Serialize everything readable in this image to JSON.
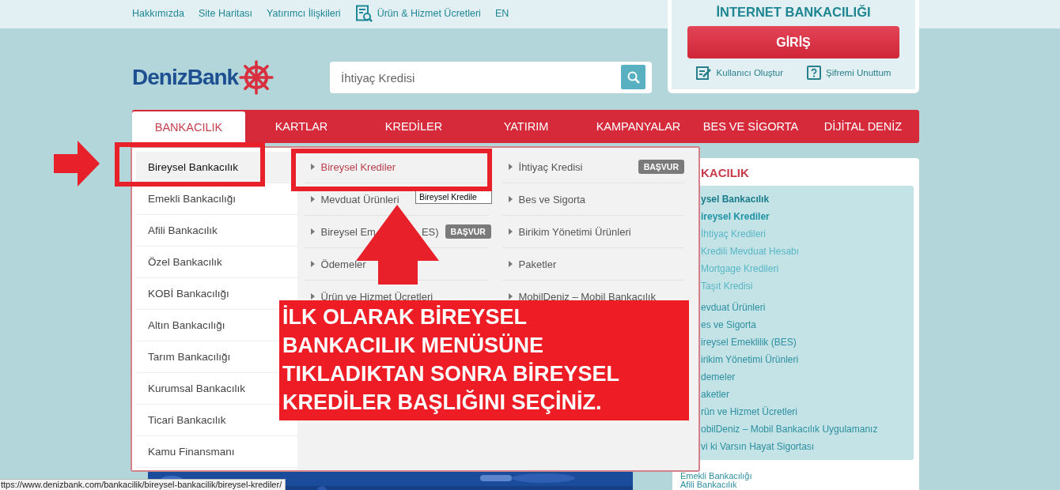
{
  "top_links": [
    {
      "label": "Hakkımızda",
      "kind": "text"
    },
    {
      "label": "Site Haritası",
      "kind": "text"
    },
    {
      "label": "Yatırımcı İlişkileri",
      "kind": "text"
    },
    {
      "label": "Ürün & Hizmet Ücretleri",
      "kind": "icon"
    },
    {
      "label": "EN",
      "kind": "text"
    }
  ],
  "logo": {
    "text": "DenizBank"
  },
  "search": {
    "placeholder": "İhtiyaç Kredisi"
  },
  "login": {
    "title": "İNTERNET BANKACILIĞI",
    "button": "GİRİŞ",
    "links": [
      {
        "label": "Kullanıcı Oluştur",
        "kind": "edit"
      },
      {
        "label": "Şifremi Unuttum",
        "kind": "help"
      }
    ]
  },
  "nav": [
    {
      "label": "BANKACILIK",
      "selected": true
    },
    {
      "label": "KARTLAR",
      "selected": false
    },
    {
      "label": "KREDİLER",
      "selected": false
    },
    {
      "label": "YATIRIM",
      "selected": false
    },
    {
      "label": "KAMPANYALAR",
      "selected": false
    },
    {
      "label": "BES VE SİGORTA",
      "selected": false
    },
    {
      "label": "DİJİTAL DENİZ",
      "selected": false
    }
  ],
  "menu": {
    "categories": [
      {
        "label": "Bireysel Bankacılık",
        "selected": true
      },
      {
        "label": "Emekli Bankacılığı",
        "selected": false
      },
      {
        "label": "Afili Bankacılık",
        "selected": false
      },
      {
        "label": "Özel Bankacılık",
        "selected": false
      },
      {
        "label": "KOBİ Bankacılığı",
        "selected": false
      },
      {
        "label": "Altın Bankacılığı",
        "selected": false
      },
      {
        "label": "Tarım Bankacılığı",
        "selected": false
      },
      {
        "label": "Kurumsal Bankacılık",
        "selected": false
      },
      {
        "label": "Ticari Bankacılık",
        "selected": false
      },
      {
        "label": "Kamu Finansmanı",
        "selected": false
      }
    ],
    "column_2": [
      {
        "label": "Bireysel Krediler",
        "selected": true
      },
      {
        "label": "Mevduat Ürünleri",
        "selected": false
      },
      {
        "label": "Bireysel Em",
        "label_tail": "ES)",
        "selected": false,
        "badge": "BAŞVUR"
      },
      {
        "label": "Ödemeler",
        "selected": false
      },
      {
        "label": "Ürün ve Hizmet Ücretleri",
        "selected": false
      }
    ],
    "column_3": [
      {
        "label": "İhtiyaç Kredisi",
        "selected": false,
        "badge": "BAŞVUR"
      },
      {
        "label": "Bes ve Sigorta",
        "selected": false
      },
      {
        "label": "Birikim Yönetimi Ürünleri",
        "selected": false
      },
      {
        "label": "Paketler",
        "selected": false
      },
      {
        "label": "MobilDeniz – Mobil Bankacılık",
        "selected": false
      }
    ]
  },
  "tooltip": "Bireysel Kredile",
  "sidebar": {
    "title": "KACILIK",
    "tree": [
      {
        "label": "ysel Bankacılık",
        "children": [
          {
            "label": "ireysel Krediler",
            "children": [
              {
                "label": "İhtiyaç Kredileri"
              },
              {
                "label": "Kredili Mevduat Hesabı"
              },
              {
                "label": "Mortgage Kredileri"
              },
              {
                "label": "Taşıt Kredisi"
              }
            ]
          },
          {
            "label": "evduat Ürünleri"
          },
          {
            "label": "es ve Sigorta"
          },
          {
            "label": "ireysel Emeklilik (BES)"
          },
          {
            "label": "irikim Yönetimi Ürünleri"
          },
          {
            "label": "demeler"
          },
          {
            "label": "aketler"
          },
          {
            "label": "rün ve Hizmet Ücretleri"
          },
          {
            "label": "obilDeniz – Mobil Bankacılık Uygulamanız"
          },
          {
            "label": "vi ki Varsın Hayat Sigortası"
          }
        ]
      }
    ],
    "more": [
      "Emekli Bankacılığı",
      "Afili Bankacılık"
    ]
  },
  "annotation": {
    "lines": [
      "İLK OLARAK BİREYSEL",
      "BANKACILIK MENÜSÜNE",
      "TIKLADIKTAN SONRA BİREYSEL",
      "KREDİLER BAŞLIĞINI SEÇİNİZ."
    ]
  },
  "status_bar": {
    "url": "ttps://www.denizbank.com/bankacilik/bireysel-bankacilik/bireysel-krediler/"
  }
}
